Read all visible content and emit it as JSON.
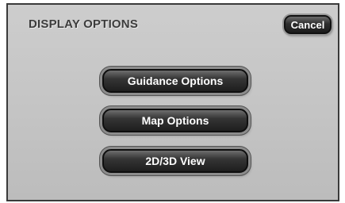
{
  "header": {
    "title": "DISPLAY OPTIONS",
    "cancel_label": "Cancel"
  },
  "menu": {
    "items": [
      {
        "label": "Guidance Options"
      },
      {
        "label": "Map Options"
      },
      {
        "label": "2D/3D View"
      }
    ]
  }
}
